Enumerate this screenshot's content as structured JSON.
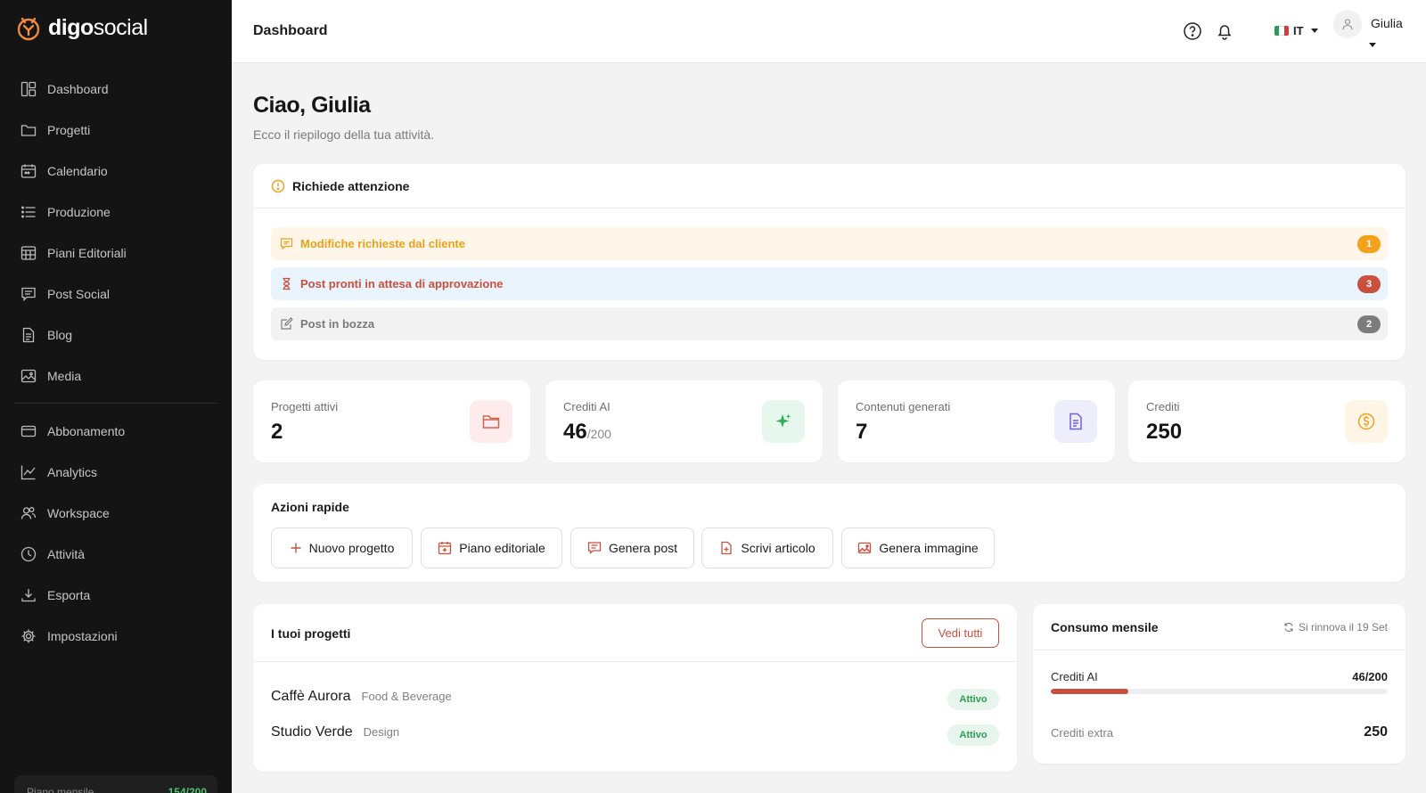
{
  "app": {
    "name_bold": "digo",
    "name_light": "social"
  },
  "sidebar": {
    "items": [
      {
        "label": "Dashboard",
        "icon": "dashboard-icon"
      },
      {
        "label": "Progetti",
        "icon": "folder-icon"
      },
      {
        "label": "Calendario",
        "icon": "calendar-icon"
      },
      {
        "label": "Produzione",
        "icon": "list-icon"
      },
      {
        "label": "Piani Editoriali",
        "icon": "grid-calendar-icon"
      },
      {
        "label": "Post Social",
        "icon": "chat-icon"
      },
      {
        "label": "Blog",
        "icon": "document-icon"
      },
      {
        "label": "Media",
        "icon": "image-icon"
      }
    ],
    "items2": [
      {
        "label": "Abbonamento",
        "icon": "card-icon"
      },
      {
        "label": "Analytics",
        "icon": "chart-icon"
      },
      {
        "label": "Workspace",
        "icon": "users-icon"
      },
      {
        "label": "Attività",
        "icon": "clock-icon"
      },
      {
        "label": "Esporta",
        "icon": "download-icon"
      },
      {
        "label": "Impostazioni",
        "icon": "gear-icon"
      }
    ],
    "plan": {
      "label": "Piano mensile",
      "value": "154/200"
    }
  },
  "header": {
    "title": "Dashboard",
    "lang": "IT",
    "user": "Giulia"
  },
  "greeting": {
    "title": "Ciao, Giulia",
    "subtitle": "Ecco il riepilogo della tua attività."
  },
  "attention": {
    "title": "Richiede attenzione",
    "items": [
      {
        "label": "Modifiche richieste dal cliente",
        "count": "1",
        "color": "#e9a11a",
        "bg": "#fff6e9",
        "icon": "comment-icon"
      },
      {
        "label": "Post pronti in attesa di approvazione",
        "count": "3",
        "color": "#c9503c",
        "bg": "#eaf4fd",
        "icon": "hourglass-icon"
      },
      {
        "label": "Post in bozza",
        "count": "2",
        "color": "#7a7a7a",
        "bg": "#f2f2f2",
        "icon": "edit-icon"
      }
    ]
  },
  "stats": [
    {
      "label": "Progetti attivi",
      "value": "2",
      "suffix": "",
      "icon": "folder-icon"
    },
    {
      "label": "Crediti AI",
      "value": "46",
      "suffix": "/200",
      "icon": "sparkle-icon"
    },
    {
      "label": "Contenuti generati",
      "value": "7",
      "suffix": "",
      "icon": "document-icon"
    },
    {
      "label": "Crediti",
      "value": "250",
      "suffix": "",
      "icon": "coin-icon"
    }
  ],
  "quick_actions": {
    "title": "Azioni rapide",
    "buttons": [
      {
        "label": "Nuovo progetto",
        "icon": "plus-icon"
      },
      {
        "label": "Piano editoriale",
        "icon": "calendar-plus-icon"
      },
      {
        "label": "Genera post",
        "icon": "chat-icon"
      },
      {
        "label": "Scrivi articolo",
        "icon": "document-plus-icon"
      },
      {
        "label": "Genera immagine",
        "icon": "image-icon"
      }
    ]
  },
  "projects": {
    "title": "I tuoi progetti",
    "see_all": "Vedi tutti",
    "items": [
      {
        "name": "Caffè Aurora",
        "category": "Food & Beverage",
        "status": "Attivo"
      },
      {
        "name": "Studio Verde",
        "category": "Design",
        "status": "Attivo"
      }
    ]
  },
  "usage": {
    "title": "Consumo mensile",
    "renew": "Si rinnova il 19 Set",
    "ai_label": "Crediti AI",
    "ai_value": "46/200",
    "ai_fraction": 0.23,
    "extra_label": "Crediti extra",
    "extra_value": "250"
  },
  "colors": {
    "accent": "#c8503c",
    "sidebar_bg": "#141414",
    "success": "#2f9a55"
  }
}
